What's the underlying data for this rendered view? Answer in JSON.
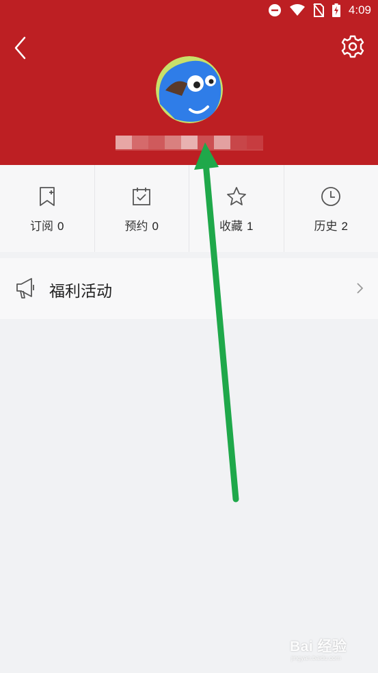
{
  "status_bar": {
    "time": "4:09",
    "icons": [
      "do-not-disturb-icon",
      "wifi-icon",
      "no-sim-icon",
      "battery-charging-icon"
    ]
  },
  "header": {
    "back_icon": "back-arrow-icon",
    "settings_icon": "gear-icon",
    "username_blurred": true
  },
  "stats": [
    {
      "label": "订阅",
      "count": "0",
      "icon": "bookmark-add-icon"
    },
    {
      "label": "预约",
      "count": "0",
      "icon": "calendar-check-icon"
    },
    {
      "label": "收藏",
      "count": "1",
      "icon": "star-icon"
    },
    {
      "label": "历史",
      "count": "2",
      "icon": "clock-icon"
    }
  ],
  "welfare": {
    "label": "福利活动",
    "icon": "megaphone-icon"
  },
  "watermark": {
    "text": "Bai 经验",
    "sub": "jingyan.baidu.com"
  },
  "colors": {
    "header_bg": "#bd1f23",
    "page_bg": "#f1f2f4",
    "annotation_arrow": "#1fa84a"
  }
}
